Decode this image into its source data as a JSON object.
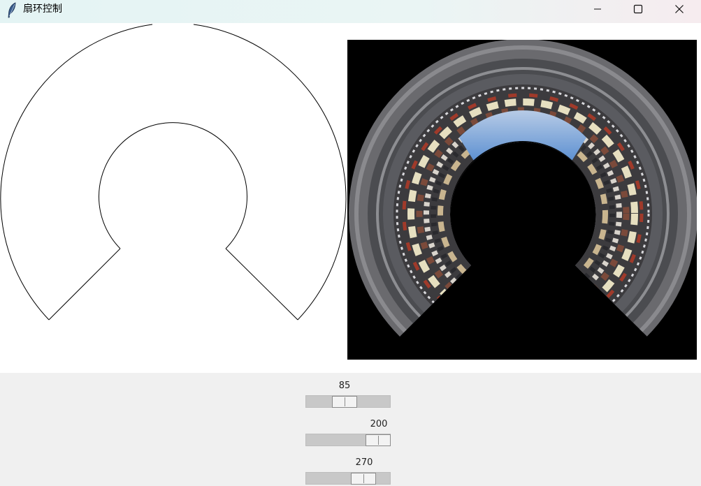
{
  "window": {
    "title": "扇环控制",
    "app_icon": "feather-icon",
    "controls": {
      "minimize": "minimize-icon",
      "maximize": "maximize-icon",
      "close": "close-icon"
    }
  },
  "canvas": {
    "left": {
      "shape": "annular-sector-outline",
      "stroke_color": "#000000",
      "background": "#ffffff"
    },
    "right": {
      "content": "annular-sector-panorama",
      "background": "#000000"
    }
  },
  "controls": {
    "scales": [
      {
        "name": "scale-1",
        "value": "85",
        "position_fraction": 0.45
      },
      {
        "name": "scale-2",
        "value": "200",
        "position_fraction": 0.85
      },
      {
        "name": "scale-3",
        "value": "270",
        "position_fraction": 0.67
      }
    ]
  },
  "colors": {
    "titlebar_start": "#e4f4f4",
    "titlebar_end": "#f6ecef",
    "control_bg": "#f0f0f0",
    "trough": "#c8c8c8"
  }
}
